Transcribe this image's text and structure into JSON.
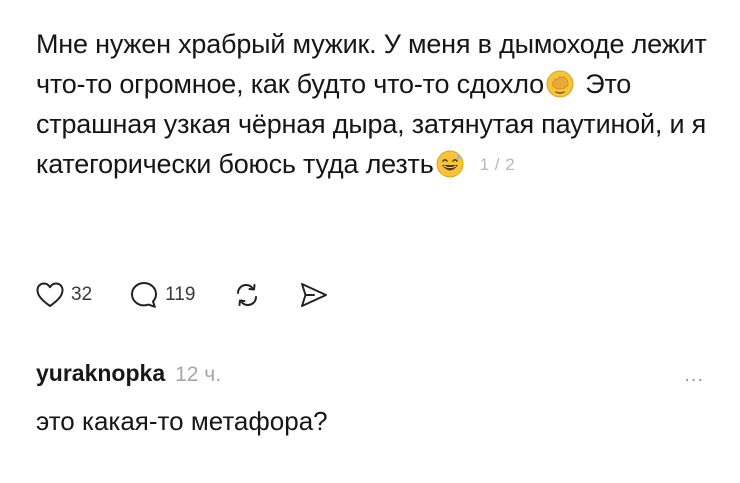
{
  "post": {
    "text_1": "Мне нужен храбрый мужик. У меня в дымоходе лежит что-то огромное, как будто что-то сдохло",
    "emoji_1": "face-with-hand-over-eyes-emoji",
    "text_2": " Это страшная узкая чёрная дыра, затянутая паутиной, и я категорически боюсь туда лезть",
    "emoji_2": "sweat-smile-emoji",
    "page_counter": "1 / 2"
  },
  "actions": {
    "like": {
      "icon": "heart-icon",
      "count": "32"
    },
    "comment": {
      "icon": "speech-bubble-icon",
      "count": "119"
    },
    "repost": {
      "icon": "repost-icon"
    },
    "share": {
      "icon": "send-icon"
    }
  },
  "comment": {
    "author": "yuraknopka",
    "time": "12 ч.",
    "text": "это какая-то метафора?",
    "more_icon": "more-dots-icon",
    "more_label": "..."
  },
  "colors": {
    "text": "#161616",
    "muted": "#a6a6a6",
    "emoji_yellow": "#f5c43c"
  }
}
